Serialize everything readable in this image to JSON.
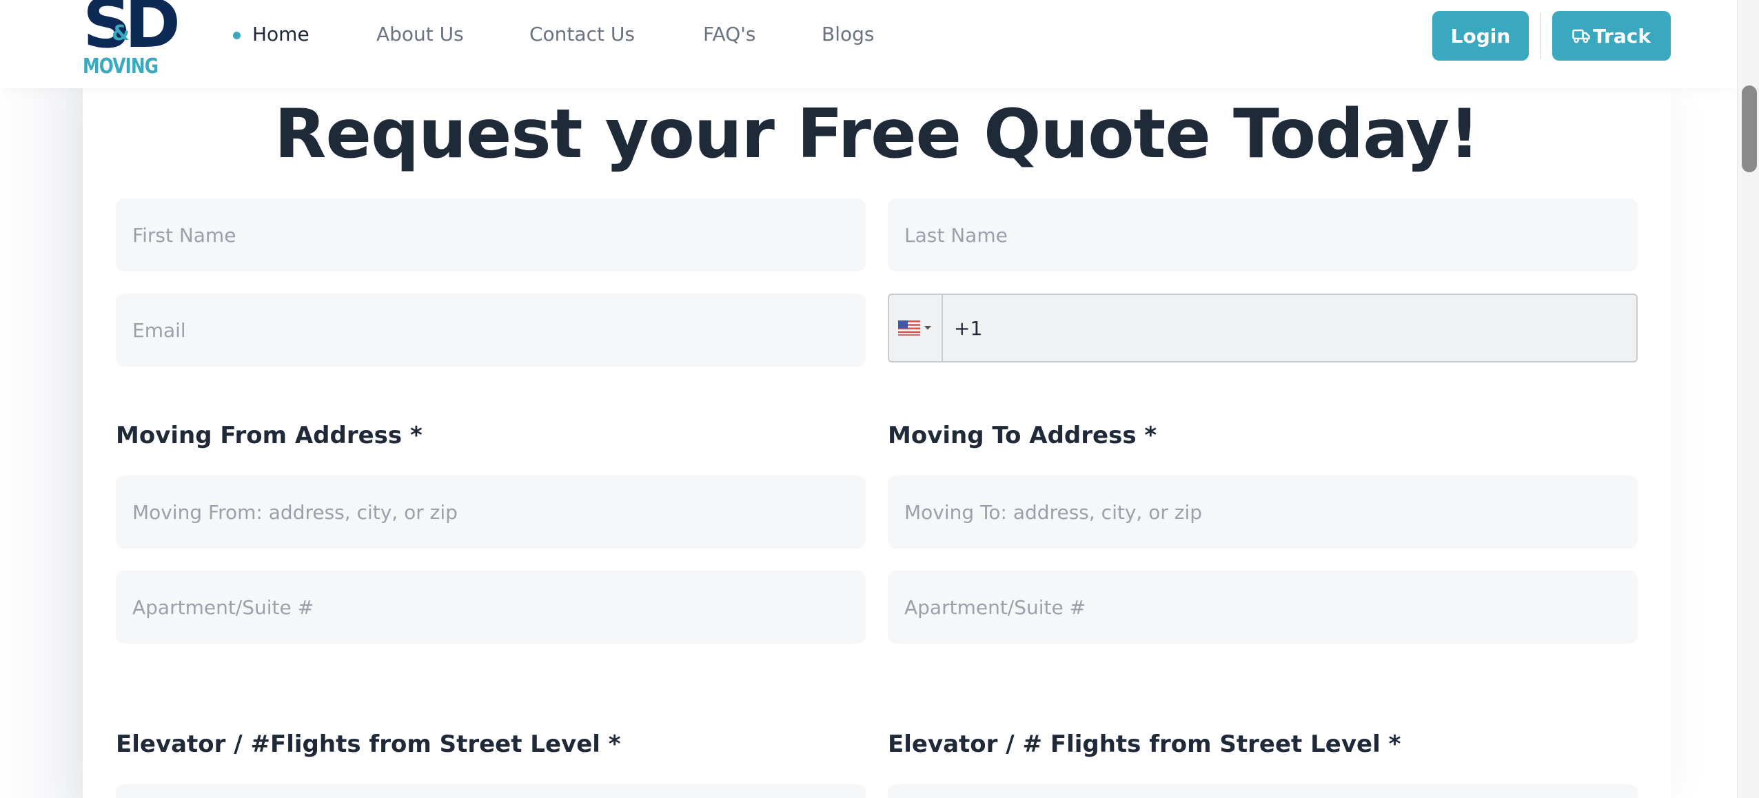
{
  "header": {
    "logo": {
      "top": "SD",
      "amp": "&",
      "bottom": "MOVING"
    },
    "nav": [
      {
        "label": "Home",
        "active": true
      },
      {
        "label": "About Us"
      },
      {
        "label": "Contact Us"
      },
      {
        "label": "FAQ's"
      },
      {
        "label": "Blogs"
      }
    ],
    "login_label": "Login",
    "track_label": "Track"
  },
  "form": {
    "title": "Request your Free Quote Today!",
    "first_name_placeholder": "First Name",
    "last_name_placeholder": "Last Name",
    "email_placeholder": "Email",
    "phone": {
      "country": "us-flag-icon",
      "value": "+1"
    },
    "moving_from_label": "Moving From Address *",
    "moving_to_label": "Moving To Address *",
    "moving_from_placeholder": "Moving From: address, city, or zip",
    "moving_to_placeholder": "Moving To: address, city, or zip",
    "apt_from_placeholder": "Apartment/Suite #",
    "apt_to_placeholder": "Apartment/Suite #",
    "elevator_from_label": "Elevator / #Flights from Street Level *",
    "elevator_to_label": "Elevator / # Flights from Street Level *"
  },
  "colors": {
    "accent": "#3aa9bf",
    "brand_navy": "#0d2a57"
  }
}
